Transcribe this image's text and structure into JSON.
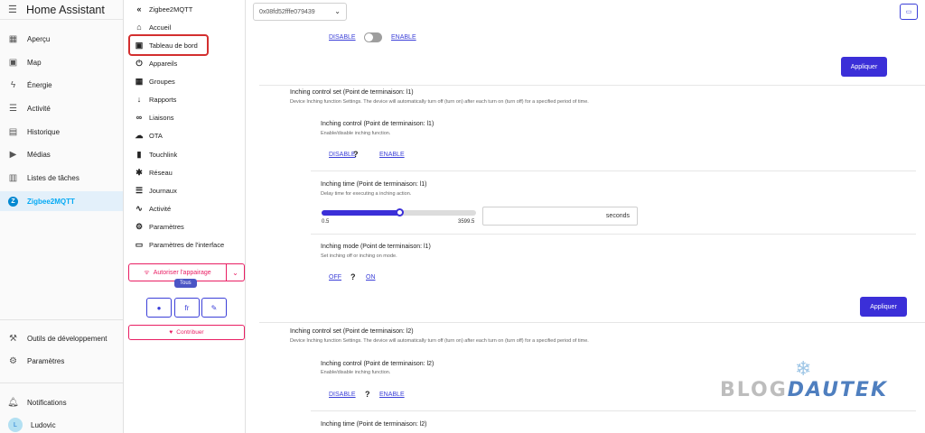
{
  "ha": {
    "title": "Home Assistant",
    "items": [
      {
        "label": "Aperçu",
        "icon": "grid-icon"
      },
      {
        "label": "Map",
        "icon": "person-icon"
      },
      {
        "label": "Énergie",
        "icon": "bolt-icon"
      },
      {
        "label": "Activité",
        "icon": "list-icon"
      },
      {
        "label": "Historique",
        "icon": "chart-icon"
      },
      {
        "label": "Médias",
        "icon": "play-icon"
      },
      {
        "label": "Listes de tâches",
        "icon": "clipboard-icon"
      },
      {
        "label": "Zigbee2MQTT",
        "icon": "zigbee-icon"
      }
    ],
    "dev_tools": "Outils de développement",
    "settings": "Paramètres",
    "notifications": "Notifications",
    "user": {
      "name": "Ludovic",
      "initial": "L"
    }
  },
  "z2m": {
    "header": "Zigbee2MQTT",
    "items": [
      "Accueil",
      "Tableau de bord",
      "Appareils",
      "Groupes",
      "Rapports",
      "Liaisons",
      "OTA",
      "Touchlink",
      "Réseau",
      "Journaux",
      "Activité",
      "Paramètres",
      "Paramètres de l'interface"
    ],
    "permit_join": "Autoriser l'appairage",
    "tous": "Tous",
    "lang": "fr",
    "contribute": "Contribuer"
  },
  "main": {
    "device": "0x08fd52fffe079439",
    "top_disable": "DISABLE",
    "top_enable": "ENABLE",
    "apply_label": "Appliquer",
    "section1": {
      "title": "Inching control set (Point de terminaison: l1)",
      "desc": "Device Inching function Settings. The device will automatically turn off (turn on) after each turn on (turn off) for a specified period of time.",
      "control_title": "Inching control (Point de terminaison: l1)",
      "control_desc": "Enable/disable inching function.",
      "disable": "DISABLE",
      "enable": "ENABLE",
      "time_title": "Inching time (Point de terminaison: l1)",
      "time_desc": "Delay time for executing a inching action.",
      "slider_min": "0.5",
      "slider_max": "3599.5",
      "slider_fraction": 0.5,
      "unit": "seconds",
      "mode_title": "Inching mode (Point de terminaison: l1)",
      "mode_desc": "Set inching off or inching on mode.",
      "off": "OFF",
      "on": "ON"
    },
    "section2": {
      "title": "Inching control set (Point de terminaison: l2)",
      "desc": "Device Inching function Settings. The device will automatically turn off (turn on) after each turn on (turn off) for a specified period of time.",
      "control_title": "Inching control (Point de terminaison: l2)",
      "control_desc": "Enable/disable inching function.",
      "disable": "DISABLE",
      "enable": "ENABLE",
      "time_title": "Inching time (Point de terminaison: l2)"
    },
    "question": "?"
  },
  "watermark": {
    "part1": "BLOG",
    "part2": "DAUTEK"
  }
}
